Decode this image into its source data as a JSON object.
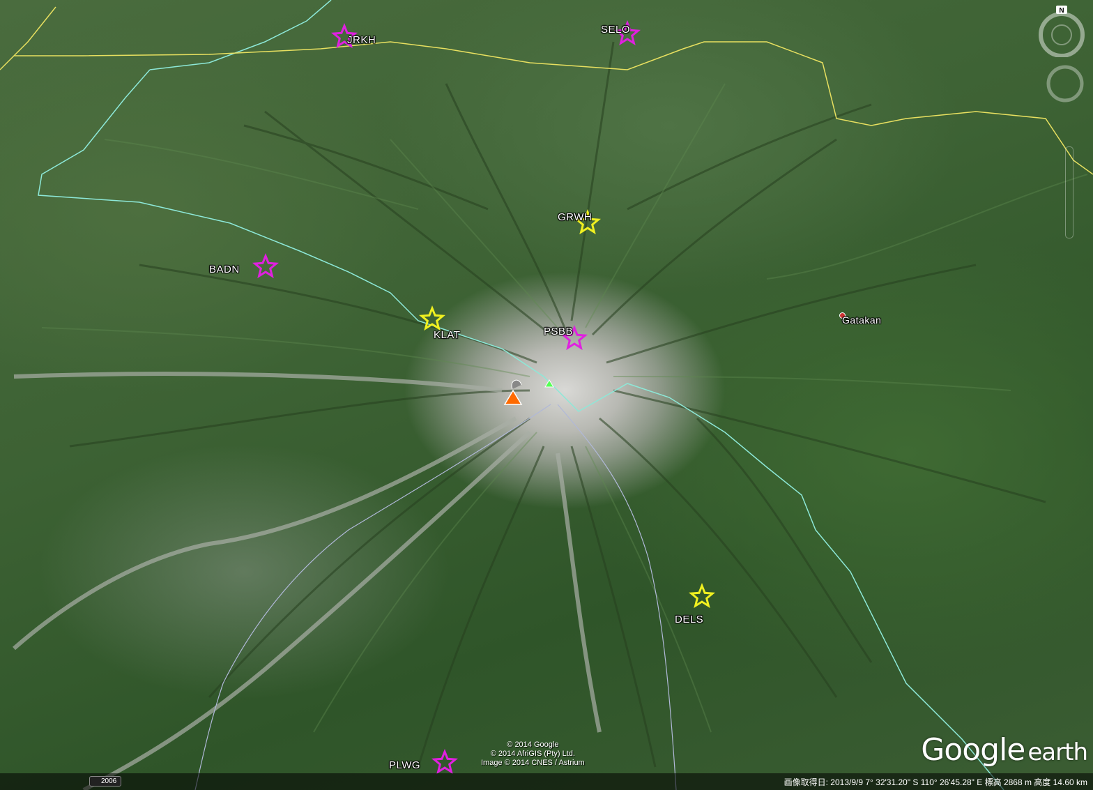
{
  "stations": [
    {
      "id": "jrkh",
      "label": "JRKH",
      "color": "#e020e0"
    },
    {
      "id": "selo",
      "label": "SELO",
      "color": "#e020e0"
    },
    {
      "id": "grwh",
      "label": "GRWH",
      "color": "#f0f020"
    },
    {
      "id": "badn",
      "label": "BADN",
      "color": "#e020e0"
    },
    {
      "id": "klat",
      "label": "KLAT",
      "color": "#f0f020"
    },
    {
      "id": "psbb",
      "label": "PSBB",
      "color": "#e020e0"
    },
    {
      "id": "dels",
      "label": "DELS",
      "color": "#f0f020"
    },
    {
      "id": "plwg",
      "label": "PLWG",
      "color": "#e020e0"
    }
  ],
  "places": {
    "gatakan": "Gatakan"
  },
  "icons": {
    "volcano": "volcano-icon",
    "peak": "peak-icon",
    "compass": "compass-icon"
  },
  "compass": {
    "north": "N"
  },
  "logo": {
    "google": "Google",
    "earth": "earth"
  },
  "copyright": {
    "line1": "© 2014 Google",
    "line2": "© 2014 AfriGIS (Pty) Ltd.",
    "line3": "Image © 2014 CNES / Astrium"
  },
  "statusbar": {
    "year": "2006",
    "info": "画像取得日: 2013/9/9    7° 32'31.20\" S 110° 26'45.28\" E 標高 2868 m    高度 14.60 km"
  },
  "colors": {
    "border_cyan": "#8de8d8",
    "border_yellow": "#e8e060",
    "road": "#b0b8d8",
    "magenta": "#e020e0",
    "yellow": "#f0f020"
  }
}
